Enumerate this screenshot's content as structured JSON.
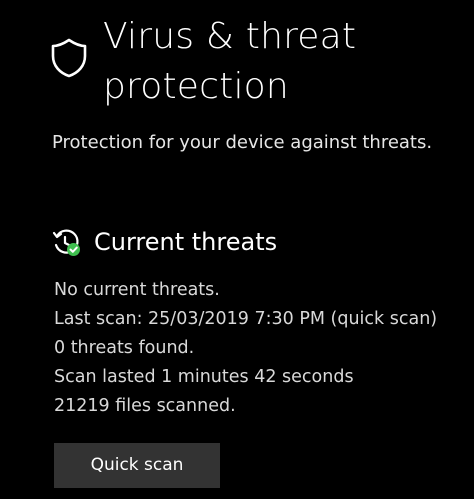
{
  "header": {
    "title": "Virus & threat protection",
    "subtitle": "Protection for your device against threats."
  },
  "current_threats": {
    "title": "Current threats",
    "status_lines": [
      "No current threats.",
      "Last scan: 25/03/2019 7:30 PM (quick scan)",
      "0 threats found.",
      "Scan lasted 1 minutes 42 seconds",
      "21219 files scanned."
    ],
    "quick_scan_label": "Quick scan"
  },
  "colors": {
    "background": "#000000",
    "text": "#ffffff",
    "secondary_text": "#d9d9d9",
    "button_bg": "#333333",
    "status_ok": "#3fbf4f"
  },
  "icons": {
    "header": "shield-icon",
    "section": "history-check-icon"
  }
}
